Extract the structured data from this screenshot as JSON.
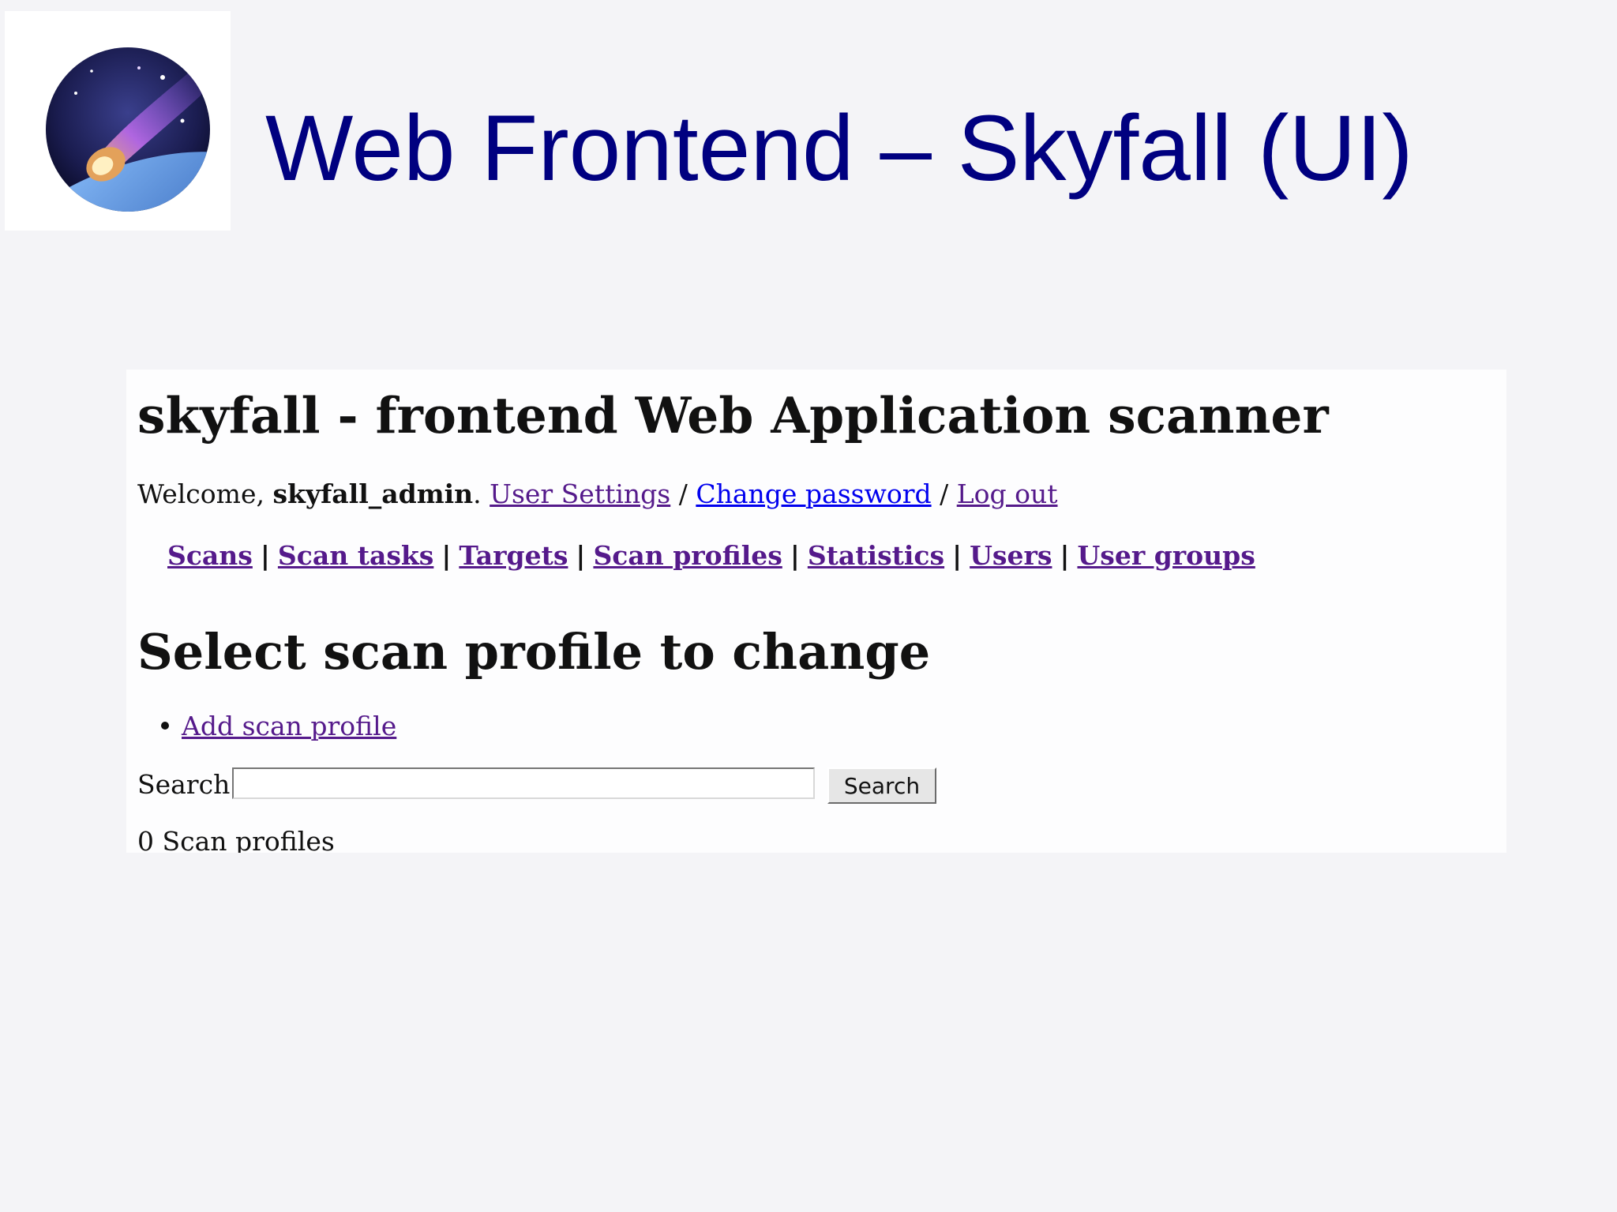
{
  "slide": {
    "title": "Web Frontend – Skyfall (UI)",
    "title_color": "#000080",
    "logo_icon": "meteor-logo"
  },
  "app": {
    "title": "skyfall - frontend Web Application scanner",
    "welcome_prefix": "Welcome, ",
    "username": "skyfall_admin",
    "welcome_suffix": ".",
    "user_links": [
      {
        "label": "User Settings"
      },
      {
        "label": "Change password"
      },
      {
        "label": "Log out"
      }
    ],
    "user_link_separator": "/",
    "nav": {
      "separator": "|",
      "items": [
        {
          "label": "Scans"
        },
        {
          "label": "Scan tasks"
        },
        {
          "label": "Targets"
        },
        {
          "label": "Scan profiles"
        },
        {
          "label": "Statistics"
        },
        {
          "label": "Users"
        },
        {
          "label": "User groups"
        }
      ]
    },
    "section_title": "Select scan profile to change",
    "actions": [
      {
        "label": "Add scan profile"
      }
    ],
    "search": {
      "label": "Search",
      "value": "",
      "button_label": "Search"
    },
    "result_count": "0 Scan profiles",
    "colors": {
      "visited_link": "#551a8b",
      "link": "#0000ee",
      "page_background": "#f4f4f7"
    }
  }
}
